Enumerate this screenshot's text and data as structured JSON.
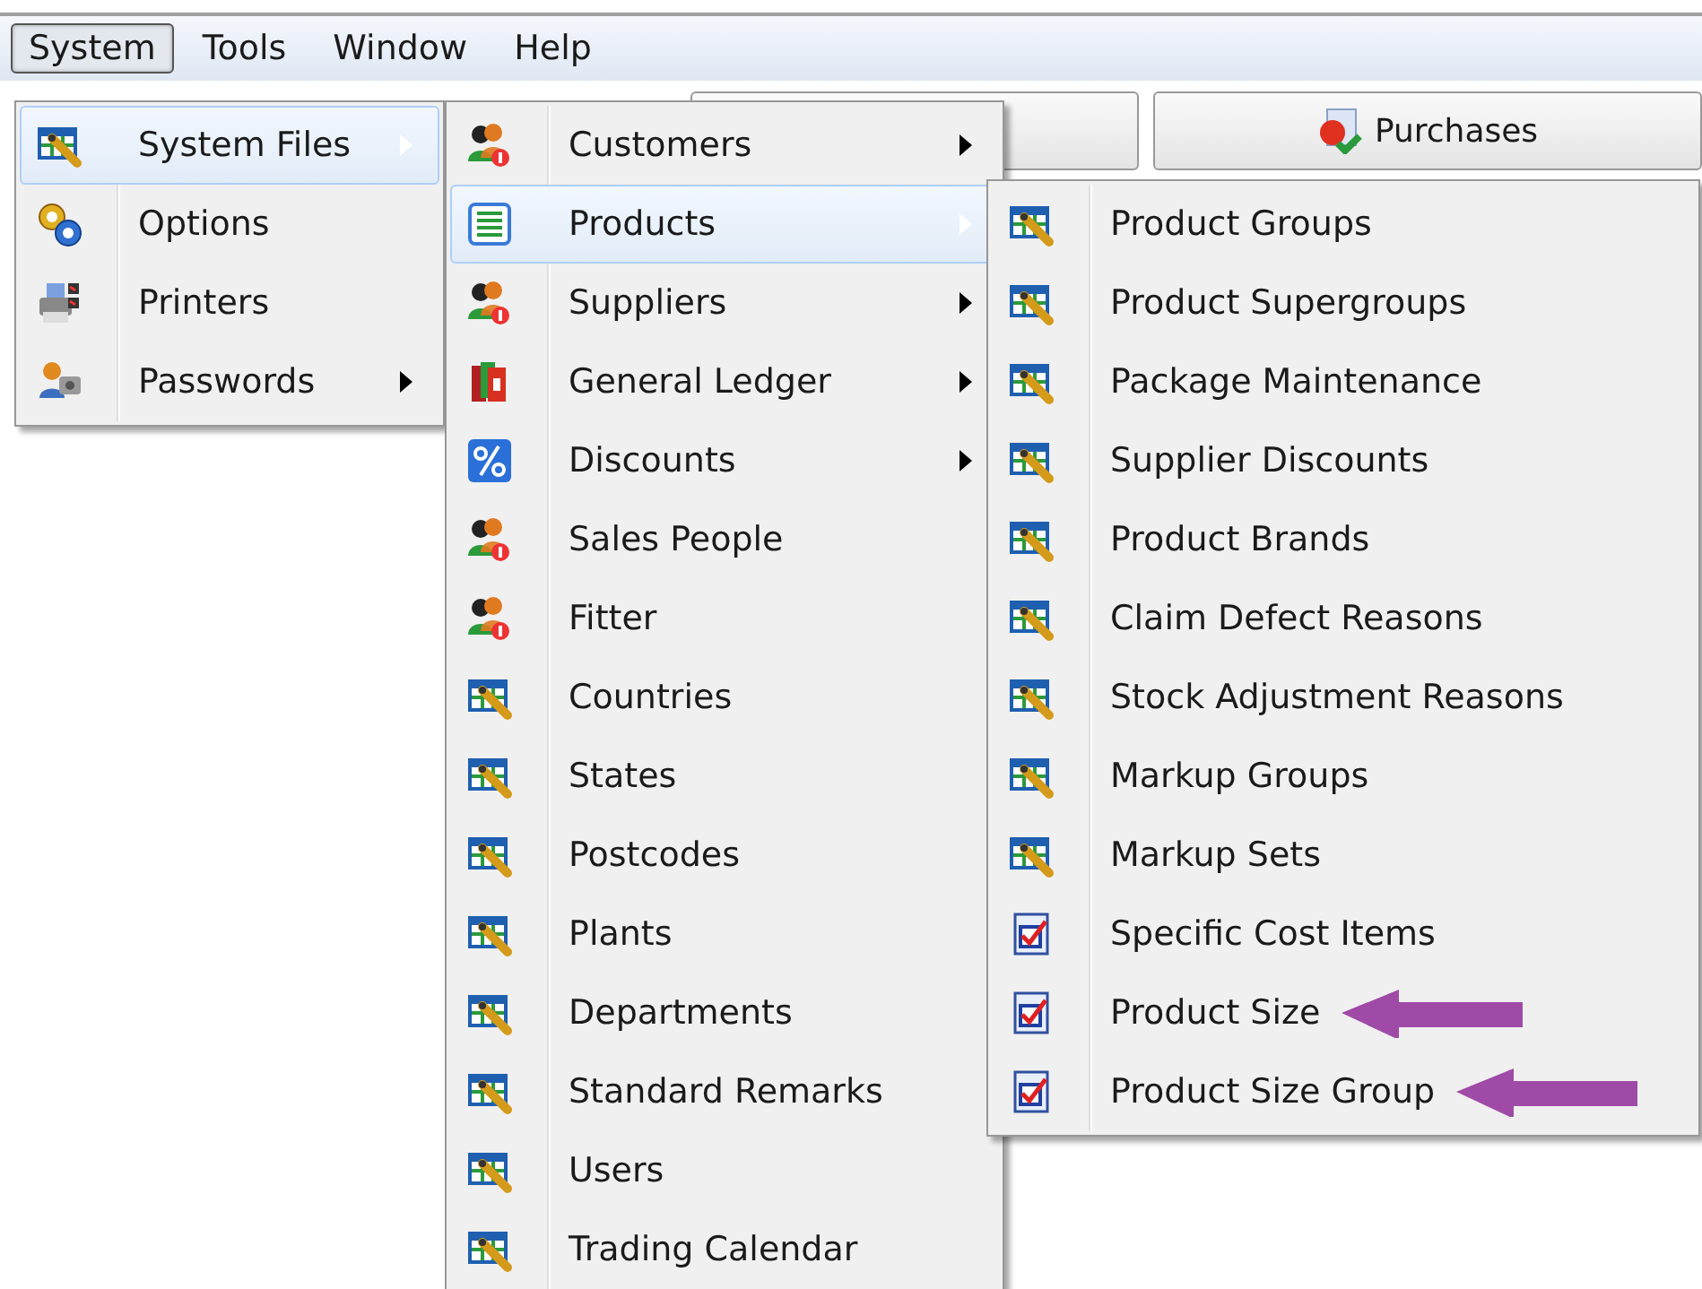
{
  "menu_bar": [
    {
      "label": "System",
      "selected": true
    },
    {
      "label": "Tools",
      "selected": false
    },
    {
      "label": "Window",
      "selected": false
    },
    {
      "label": "Help",
      "selected": false
    }
  ],
  "toolbar": [
    {
      "kind": "plain"
    },
    {
      "label": "Purchases",
      "kind": "purchase"
    }
  ],
  "system_menu": [
    {
      "label": "System Files",
      "kind": "table",
      "submenu": true,
      "selected": true
    },
    {
      "label": "Options",
      "kind": "gears",
      "submenu": false,
      "selected": false
    },
    {
      "label": "Printers",
      "kind": "printer",
      "submenu": false,
      "selected": false
    },
    {
      "label": "Passwords",
      "kind": "keys",
      "submenu": true,
      "selected": false
    }
  ],
  "system_files_menu": [
    {
      "label": "Customers",
      "kind": "people",
      "submenu": true,
      "selected": false
    },
    {
      "label": "Products",
      "kind": "list",
      "submenu": true,
      "selected": true
    },
    {
      "label": "Suppliers",
      "kind": "people",
      "submenu": true,
      "selected": false
    },
    {
      "label": "General Ledger",
      "kind": "books",
      "submenu": true,
      "selected": false
    },
    {
      "label": "Discounts",
      "kind": "percent",
      "submenu": true,
      "selected": false
    },
    {
      "label": "Sales People",
      "kind": "people",
      "submenu": false,
      "selected": false
    },
    {
      "label": "Fitter",
      "kind": "people",
      "submenu": false,
      "selected": false
    },
    {
      "label": "Countries",
      "kind": "table",
      "submenu": false,
      "selected": false
    },
    {
      "label": "States",
      "kind": "table",
      "submenu": false,
      "selected": false
    },
    {
      "label": "Postcodes",
      "kind": "table",
      "submenu": false,
      "selected": false
    },
    {
      "label": "Plants",
      "kind": "table",
      "submenu": false,
      "selected": false
    },
    {
      "label": "Departments",
      "kind": "table",
      "submenu": false,
      "selected": false
    },
    {
      "label": "Standard Remarks",
      "kind": "table",
      "submenu": false,
      "selected": false
    },
    {
      "label": "Users",
      "kind": "table",
      "submenu": false,
      "selected": false
    },
    {
      "label": "Trading Calendar",
      "kind": "table",
      "submenu": false,
      "selected": false
    }
  ],
  "products_menu": [
    {
      "label": "Product Groups",
      "kind": "table",
      "submenu": false,
      "selected": false,
      "annotated": false
    },
    {
      "label": "Product Supergroups",
      "kind": "table",
      "submenu": false,
      "selected": false,
      "annotated": false
    },
    {
      "label": "Package Maintenance",
      "kind": "table",
      "submenu": false,
      "selected": false,
      "annotated": false
    },
    {
      "label": "Supplier Discounts",
      "kind": "table",
      "submenu": false,
      "selected": false,
      "annotated": false
    },
    {
      "label": "Product Brands",
      "kind": "table",
      "submenu": false,
      "selected": false,
      "annotated": false
    },
    {
      "label": "Claim Defect Reasons",
      "kind": "table",
      "submenu": false,
      "selected": false,
      "annotated": false
    },
    {
      "label": "Stock Adjustment Reasons",
      "kind": "table",
      "submenu": false,
      "selected": false,
      "annotated": false
    },
    {
      "label": "Markup Groups",
      "kind": "table",
      "submenu": false,
      "selected": false,
      "annotated": false
    },
    {
      "label": "Markup Sets",
      "kind": "table",
      "submenu": false,
      "selected": false,
      "annotated": false
    },
    {
      "label": "Specific Cost Items",
      "kind": "checklist",
      "submenu": false,
      "selected": false,
      "annotated": false
    },
    {
      "label": "Product Size",
      "kind": "checklist",
      "submenu": false,
      "selected": false,
      "annotated": true
    },
    {
      "label": "Product Size Group",
      "kind": "checklist",
      "submenu": false,
      "selected": false,
      "annotated": true
    }
  ]
}
